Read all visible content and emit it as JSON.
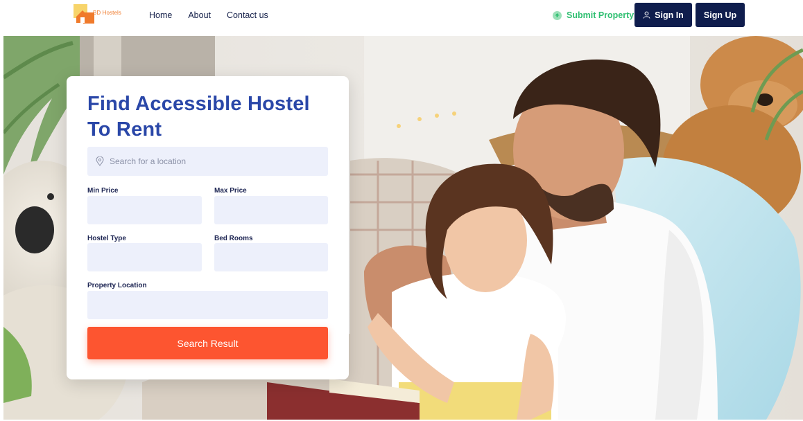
{
  "header": {
    "logo_text": "BD Hostels",
    "nav": [
      {
        "label": "Home"
      },
      {
        "label": "About"
      },
      {
        "label": "Contact us"
      }
    ],
    "submit_property_label": "Submit Property",
    "sign_in_label": "Sign In",
    "sign_up_label": "Sign Up"
  },
  "search_card": {
    "title": "Find Accessible Hostel To Rent",
    "location_search": {
      "placeholder": "Search for a location",
      "value": ""
    },
    "fields": {
      "min_price_label": "Min Price",
      "max_price_label": "Max Price",
      "hostel_type_label": "Hostel Type",
      "bed_rooms_label": "Bed Rooms",
      "property_location_label": "Property Location"
    },
    "search_button_label": "Search Result"
  },
  "colors": {
    "primary_dark": "#0f1d4d",
    "accent_orange": "#fd5530",
    "title_blue": "#2a47a8",
    "submit_green": "#2fbf71",
    "field_bg": "#edf0fb"
  },
  "icons": {
    "logo": "house-logo-icon",
    "submit_property": "upload-icon",
    "sign_in": "user-icon",
    "location": "map-pin-icon"
  }
}
